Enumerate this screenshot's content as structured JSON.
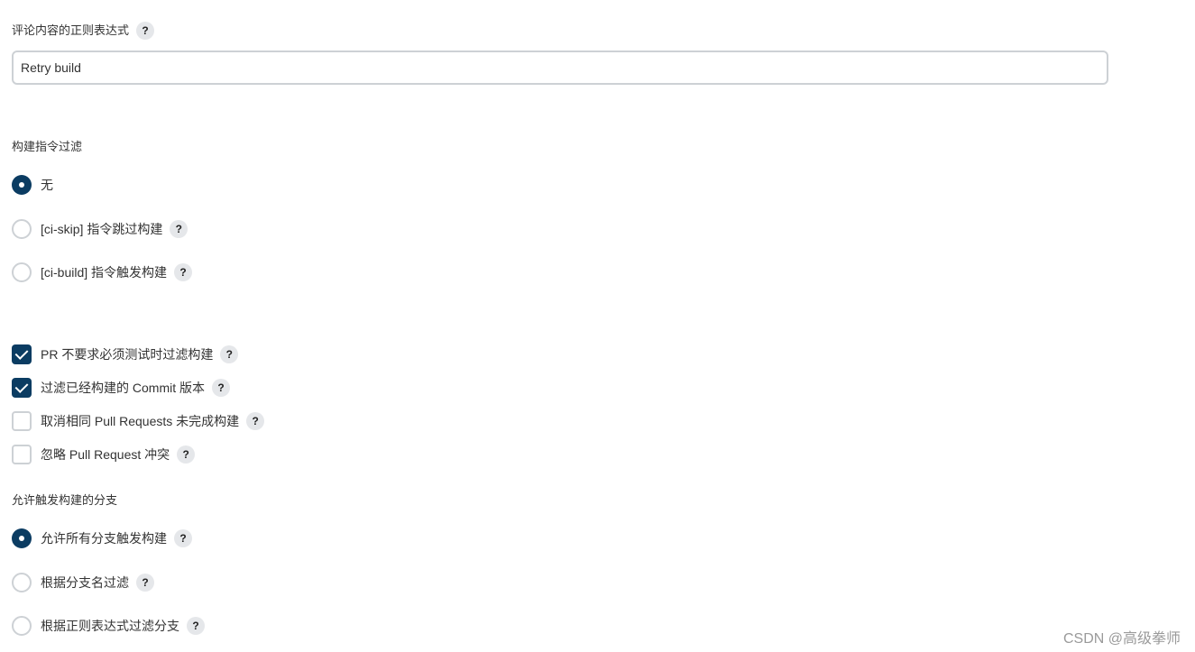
{
  "comment_regex": {
    "label": "评论内容的正则表达式",
    "help": "?",
    "value": "Retry build"
  },
  "build_command_filter": {
    "label": "构建指令过滤",
    "options": [
      {
        "label": "无",
        "checked": true
      },
      {
        "label": "[ci-skip] 指令跳过构建",
        "help": "?",
        "checked": false
      },
      {
        "label": "[ci-build] 指令触发构建",
        "help": "?",
        "checked": false
      }
    ]
  },
  "checkboxes": [
    {
      "label": "PR 不要求必须测试时过滤构建",
      "help": "?",
      "checked": true
    },
    {
      "label": "过滤已经构建的 Commit 版本",
      "help": "?",
      "checked": true
    },
    {
      "label": "取消相同 Pull Requests 未完成构建",
      "help": "?",
      "checked": false
    },
    {
      "label": "忽略 Pull Request 冲突",
      "help": "?",
      "checked": false
    }
  ],
  "branch_trigger": {
    "label": "允许触发构建的分支",
    "options": [
      {
        "label": "允许所有分支触发构建",
        "help": "?",
        "checked": true
      },
      {
        "label": "根据分支名过滤",
        "help": "?",
        "checked": false
      },
      {
        "label": "根据正则表达式过滤分支",
        "help": "?",
        "checked": false
      }
    ]
  },
  "watermark": "CSDN @高级拳师",
  "colors": {
    "accent": "#0b3c62",
    "border": "#cdd1d5",
    "help_bg": "#e5e7ea"
  }
}
